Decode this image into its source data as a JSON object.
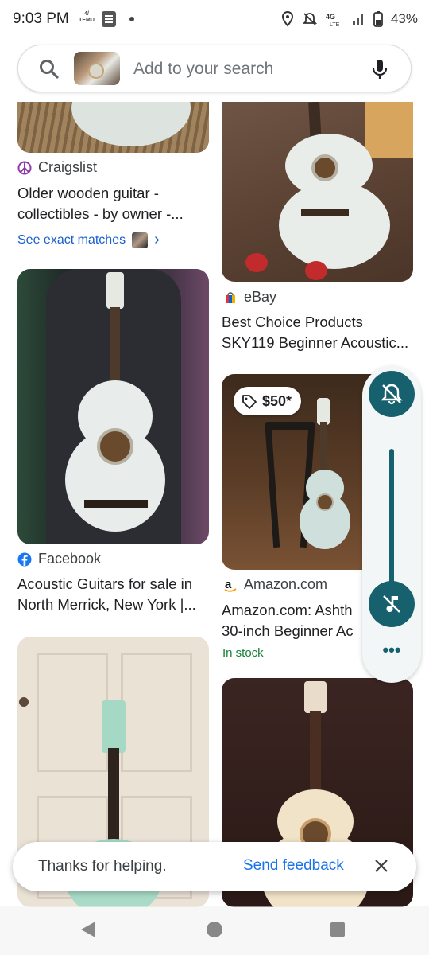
{
  "status_bar": {
    "time": "9:03 PM",
    "temu_badge": "4/\\n TEMU",
    "battery": "43%",
    "icons": [
      "notification-icon",
      "location-icon",
      "mute-icon",
      "4g-lte-icon",
      "signal-icon",
      "battery-icon"
    ]
  },
  "search": {
    "placeholder": "Add to your search"
  },
  "results": [
    {
      "source": "Craigslist",
      "title_line1": "Older wooden guitar -",
      "title_line2": "collectibles - by owner -...",
      "exact_matches": "See exact matches",
      "chevron": "›"
    },
    {
      "source": "eBay",
      "title_line1": "Best Choice Products",
      "title_line2": "SKY119 Beginner Acoustic..."
    },
    {
      "source": "Facebook",
      "title_line1": "Acoustic Guitars for sale in",
      "title_line2": "North Merrick, New York |..."
    },
    {
      "source": "Amazon.com",
      "price": "$50*",
      "title_line1": "Amazon.com: Ashth",
      "title_line2": "30-inch Beginner Ac",
      "stock": "In stock"
    }
  ],
  "volume_panel": {
    "more": "•••"
  },
  "toast": {
    "message": "Thanks for helping.",
    "action": "Send feedback"
  },
  "colors": {
    "accent_teal": "#17616f",
    "link_blue": "#1a73e8",
    "stock_green": "#188038"
  }
}
